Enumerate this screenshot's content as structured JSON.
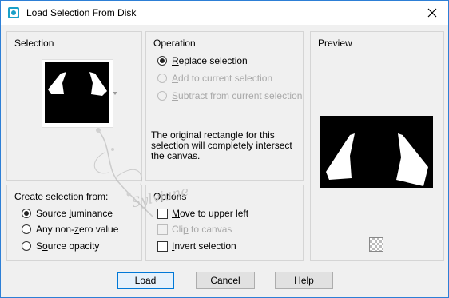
{
  "window": {
    "title": "Load Selection From Disk"
  },
  "selection": {
    "label": "Selection"
  },
  "operation": {
    "label": "Operation",
    "options": [
      {
        "pre": "",
        "key": "R",
        "post": "eplace selection",
        "checked": true,
        "disabled": false
      },
      {
        "pre": "",
        "key": "A",
        "post": "dd to current selection",
        "checked": false,
        "disabled": true
      },
      {
        "pre": "",
        "key": "S",
        "post": "ubtract from current selection",
        "checked": false,
        "disabled": true
      }
    ],
    "info": "The original rectangle for this\nselection will completely intersect\nthe canvas."
  },
  "preview": {
    "label": "Preview"
  },
  "create_from": {
    "label": "Create selection from:",
    "options": [
      {
        "pre": "Source ",
        "key": "l",
        "post": "uminance",
        "checked": true
      },
      {
        "pre": "Any non-",
        "key": "z",
        "post": "ero value",
        "checked": false
      },
      {
        "pre": "S",
        "key": "o",
        "post": "urce opacity",
        "checked": false
      }
    ]
  },
  "options": {
    "label": "Options",
    "items": [
      {
        "pre": "",
        "key": "M",
        "post": "ove to upper left",
        "checked": false,
        "disabled": false
      },
      {
        "pre": "Cli",
        "key": "p",
        "post": " to canvas",
        "checked": false,
        "disabled": true
      },
      {
        "pre": "",
        "key": "I",
        "post": "nvert selection",
        "checked": false,
        "disabled": false
      }
    ]
  },
  "watermark": {
    "text": "Sylviane"
  },
  "buttons": {
    "load": "Load",
    "cancel": "Cancel",
    "help": "Help"
  },
  "colors": {
    "accent": "#0078d7",
    "titlebar_icon": "#1aa0c8"
  }
}
